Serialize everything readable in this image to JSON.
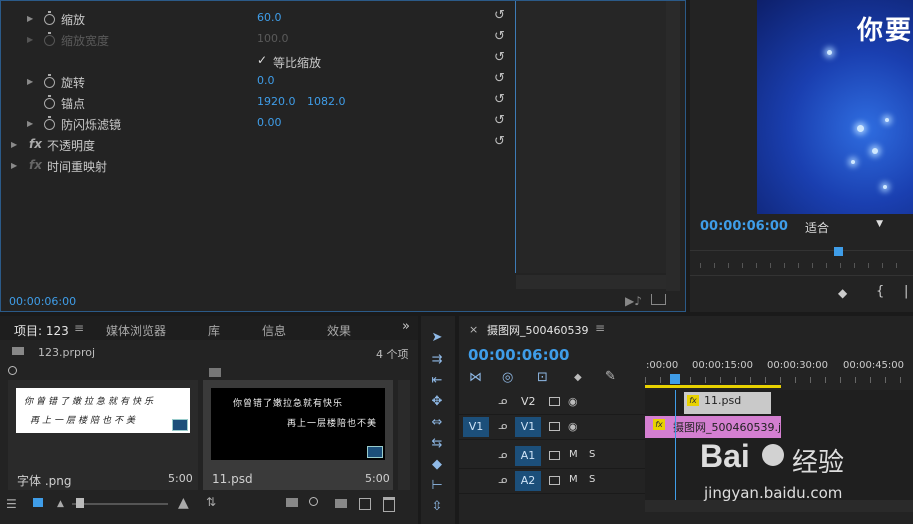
{
  "effect_controls": {
    "rows": [
      {
        "name": "缩放",
        "value": "60.0"
      },
      {
        "name": "缩放宽度",
        "value": "100.0"
      },
      {
        "name": "等比缩放",
        "checked": true
      },
      {
        "name": "旋转",
        "value": "0.0"
      },
      {
        "name": "锚点",
        "value": "1920.0",
        "value2": "1082.0"
      },
      {
        "name": "防闪烁滤镜",
        "value": "0.00"
      },
      {
        "name": "不透明度",
        "fx": "fx"
      },
      {
        "name": "时间重映射",
        "fx": "fx"
      }
    ],
    "timecode": "00:00:06:00",
    "check_glyph": "✓"
  },
  "program_monitor": {
    "preview_text": "你要",
    "timecode": "00:00:06:00",
    "fit_label": "适合"
  },
  "project_panel": {
    "tabs": [
      "项目: 123",
      "媒体浏览器",
      "库",
      "信息",
      "效果"
    ],
    "menu_glyph": "≡",
    "overflow": "»",
    "project_file": "123.prproj",
    "item_count": "4 个项",
    "items": [
      {
        "name": "字体 .png",
        "duration": "5:00",
        "line1": "你曾错了嫩拉急就有快乐",
        "line2": "再上一层楼陪也不美"
      },
      {
        "name": "11.psd",
        "duration": "5:00",
        "line1": "你曾错了嫩拉急就有快乐",
        "line2": "再上一层楼陪也不美"
      }
    ]
  },
  "timeline": {
    "close": "×",
    "sequence_name": "摄图网_500460539",
    "menu_glyph": "≡",
    "timecode": "00:00:06:00",
    "ruler": [
      ":00:00",
      "00:00:15:00",
      "00:00:30:00",
      "00:00:45:00"
    ],
    "tracks": [
      {
        "name": "V2",
        "source": ""
      },
      {
        "name": "V1",
        "source": "V1"
      },
      {
        "name": "A1",
        "source": ""
      },
      {
        "name": "A2",
        "source": ""
      }
    ],
    "track_mute": "M",
    "track_solo": "S",
    "clips": [
      {
        "label": "11.psd",
        "fx": "fx"
      },
      {
        "label": "摄图网_500460539.j",
        "fx": "fx"
      }
    ]
  },
  "watermark": {
    "brand": "Bai",
    "suffix": "经验",
    "url": "jingyan.baidu.com"
  },
  "colors": {
    "accent": "#3f9de8",
    "clip_pink": "#d47fd1",
    "clip_gray": "#c9c9c9",
    "work_area": "#e8d200"
  }
}
